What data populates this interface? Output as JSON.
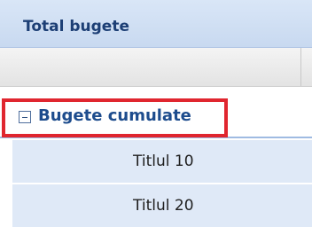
{
  "panel": {
    "title": "Total bugete"
  },
  "group": {
    "label": "Bugete cumulate",
    "expanded": true
  },
  "rows": [
    {
      "label": "Titlul 10"
    },
    {
      "label": "Titlul 20"
    }
  ],
  "colors": {
    "header_bg": "#c8d9f0",
    "title_text": "#1d3f75",
    "group_text": "#1d4c8d",
    "highlight_border": "#e0262f",
    "row_bg": "#dfe9f7"
  },
  "icons": {
    "group_toggle": "minus-square-icon"
  }
}
